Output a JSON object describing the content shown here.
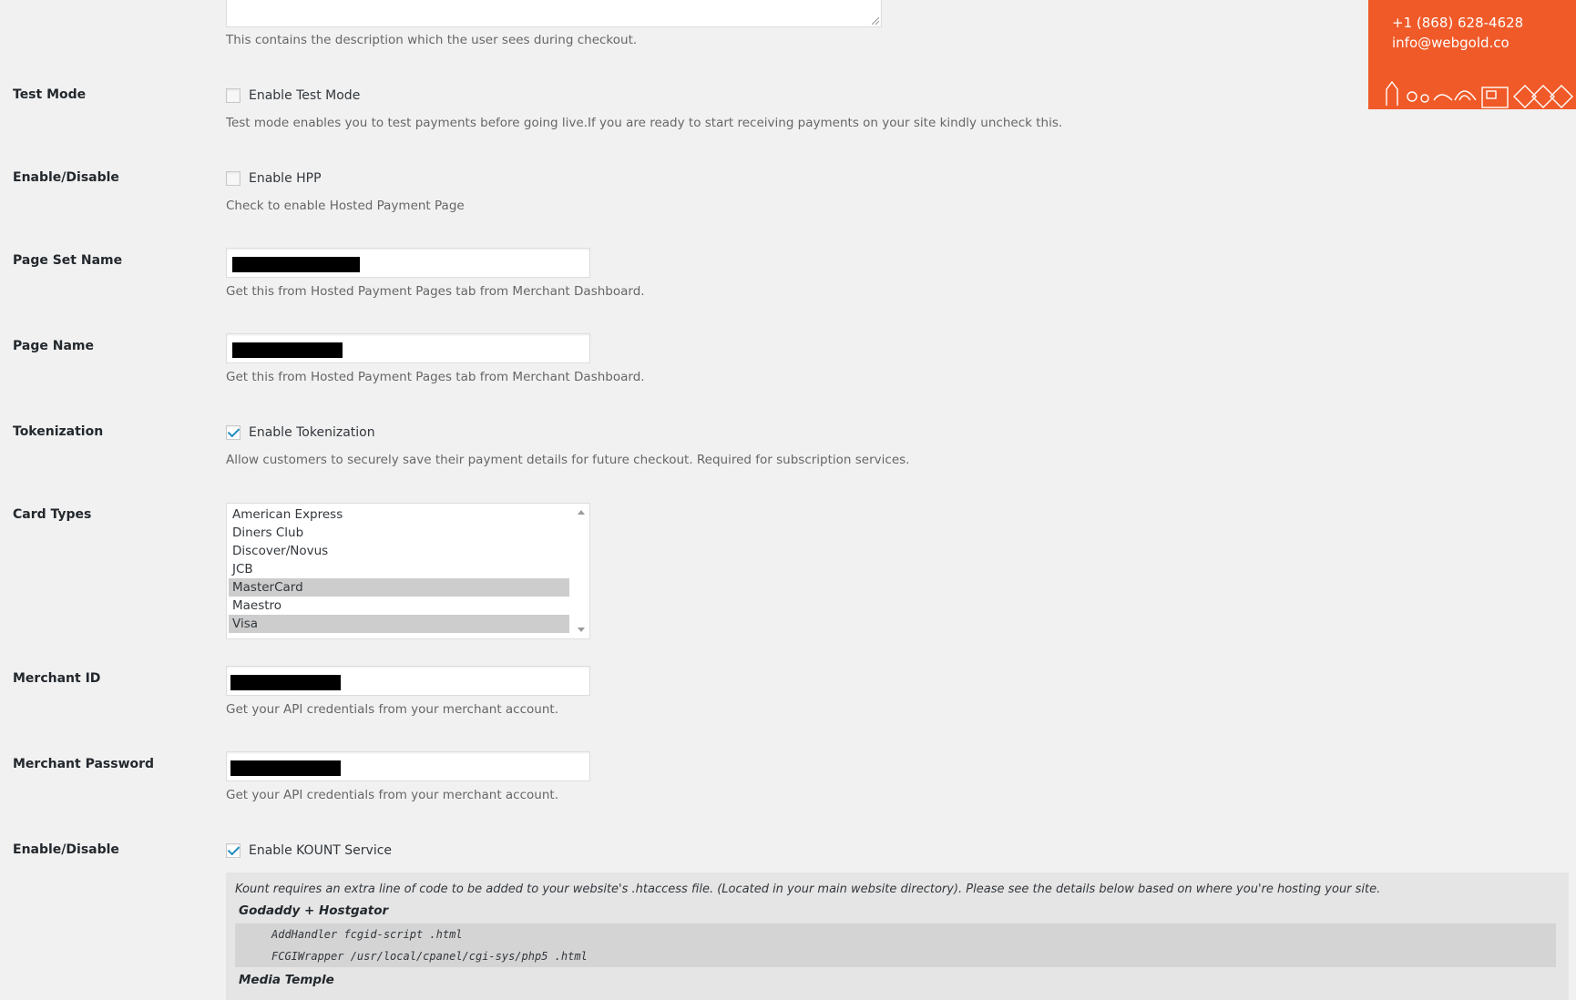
{
  "description_field": {
    "help": "This contains the description which the user sees during checkout."
  },
  "test_mode": {
    "label": "Test Mode",
    "checkbox_label": "Enable Test Mode",
    "checked": false,
    "help": "Test mode enables you to test payments before going live.If you are ready to start receiving payments on your site kindly uncheck this."
  },
  "hpp": {
    "label": "Enable/Disable",
    "checkbox_label": "Enable HPP",
    "checked": false,
    "help": "Check to enable Hosted Payment Page"
  },
  "page_set_name": {
    "label": "Page Set Name",
    "help": "Get this from Hosted Payment Pages tab from Merchant Dashboard."
  },
  "page_name": {
    "label": "Page Name",
    "help": "Get this from Hosted Payment Pages tab from Merchant Dashboard."
  },
  "tokenization": {
    "label": "Tokenization",
    "checkbox_label": "Enable Tokenization",
    "checked": true,
    "help": "Allow customers to securely save their payment details for future checkout. Required for subscription services."
  },
  "card_types": {
    "label": "Card Types",
    "options": [
      {
        "label": "American Express",
        "selected": false
      },
      {
        "label": "Diners Club",
        "selected": false
      },
      {
        "label": "Discover/Novus",
        "selected": false
      },
      {
        "label": "JCB",
        "selected": false
      },
      {
        "label": "MasterCard",
        "selected": true
      },
      {
        "label": "Maestro",
        "selected": false
      },
      {
        "label": "Visa",
        "selected": true
      }
    ]
  },
  "merchant_id": {
    "label": "Merchant ID",
    "help": "Get your API credentials from your merchant account."
  },
  "merchant_password": {
    "label": "Merchant Password",
    "help": "Get your API credentials from your merchant account."
  },
  "kount": {
    "label": "Enable/Disable",
    "checkbox_label": "Enable KOUNT Service",
    "checked": true,
    "note": "Kount requires an extra line of code to be added to your website's .htaccess file. (Located in your main website directory). Please see the details below based on where you're hosting your site.",
    "host_1": "Godaddy + Hostgator",
    "code_1": "AddHandler fcgid-script .html",
    "code_2": "FCGIWrapper /usr/local/cpanel/cgi-sys/php5 .html",
    "host_2": "Media Temple"
  },
  "promo": {
    "phone": "+1 (868) 628-4628",
    "email": "info@webgold.co",
    "background": "#f05a28"
  },
  "colors": {
    "checkmark": "#1e8cbe",
    "selected_option": "#cdcdcd"
  }
}
